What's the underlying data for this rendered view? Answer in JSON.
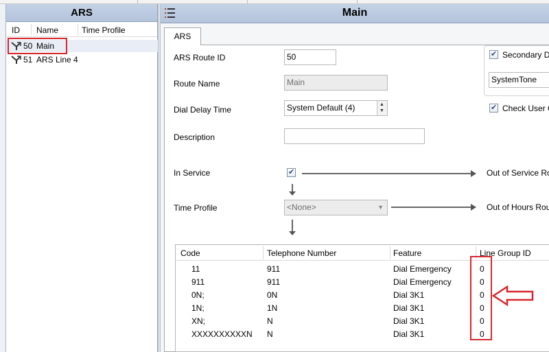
{
  "left_panel": {
    "title": "ARS",
    "columns": [
      "ID",
      "Name",
      "Time Profile"
    ],
    "rows": [
      {
        "id": "50",
        "name": "Main",
        "time_profile": ""
      },
      {
        "id": "51",
        "name": "ARS Line 4",
        "time_profile": ""
      }
    ]
  },
  "right_panel": {
    "title": "Main",
    "tab": "ARS",
    "form": {
      "route_id_label": "ARS Route ID",
      "route_id_value": "50",
      "route_name_label": "Route Name",
      "route_name_value": "Main",
      "dial_delay_label": "Dial Delay Time",
      "dial_delay_value": "System Default (4)",
      "description_label": "Description",
      "description_value": "",
      "in_service_label": "In Service",
      "time_profile_label": "Time Profile",
      "time_profile_value": "<None>",
      "out_of_service_label": "Out of Service Ro",
      "out_of_hours_label": "Out of Hours Rou",
      "secondary_dial_label": "Secondary Di",
      "secondary_tone_value": "SystemTone",
      "check_user_label": "Check User C"
    },
    "table": {
      "headers": [
        "Code",
        "Telephone Number",
        "Feature",
        "Line Group ID"
      ],
      "rows": [
        {
          "code": "11",
          "number": "911",
          "feature": "Dial Emergency",
          "group": "0"
        },
        {
          "code": "911",
          "number": "911",
          "feature": "Dial Emergency",
          "group": "0"
        },
        {
          "code": "0N;",
          "number": "0N",
          "feature": "Dial 3K1",
          "group": "0"
        },
        {
          "code": "1N;",
          "number": "1N",
          "feature": "Dial 3K1",
          "group": "0"
        },
        {
          "code": "XN;",
          "number": "N",
          "feature": "Dial 3K1",
          "group": "0"
        },
        {
          "code": "XXXXXXXXXXN",
          "number": "N",
          "feature": "Dial 3K1",
          "group": "0"
        }
      ]
    }
  },
  "colors": {
    "title_bar": "#b9c8de",
    "highlight": "#d7262e"
  },
  "icons": [
    "route-icon",
    "menu-icon",
    "spin-up-icon",
    "spin-down-icon",
    "dropdown-arrow-icon",
    "red-arrow-icon"
  ]
}
